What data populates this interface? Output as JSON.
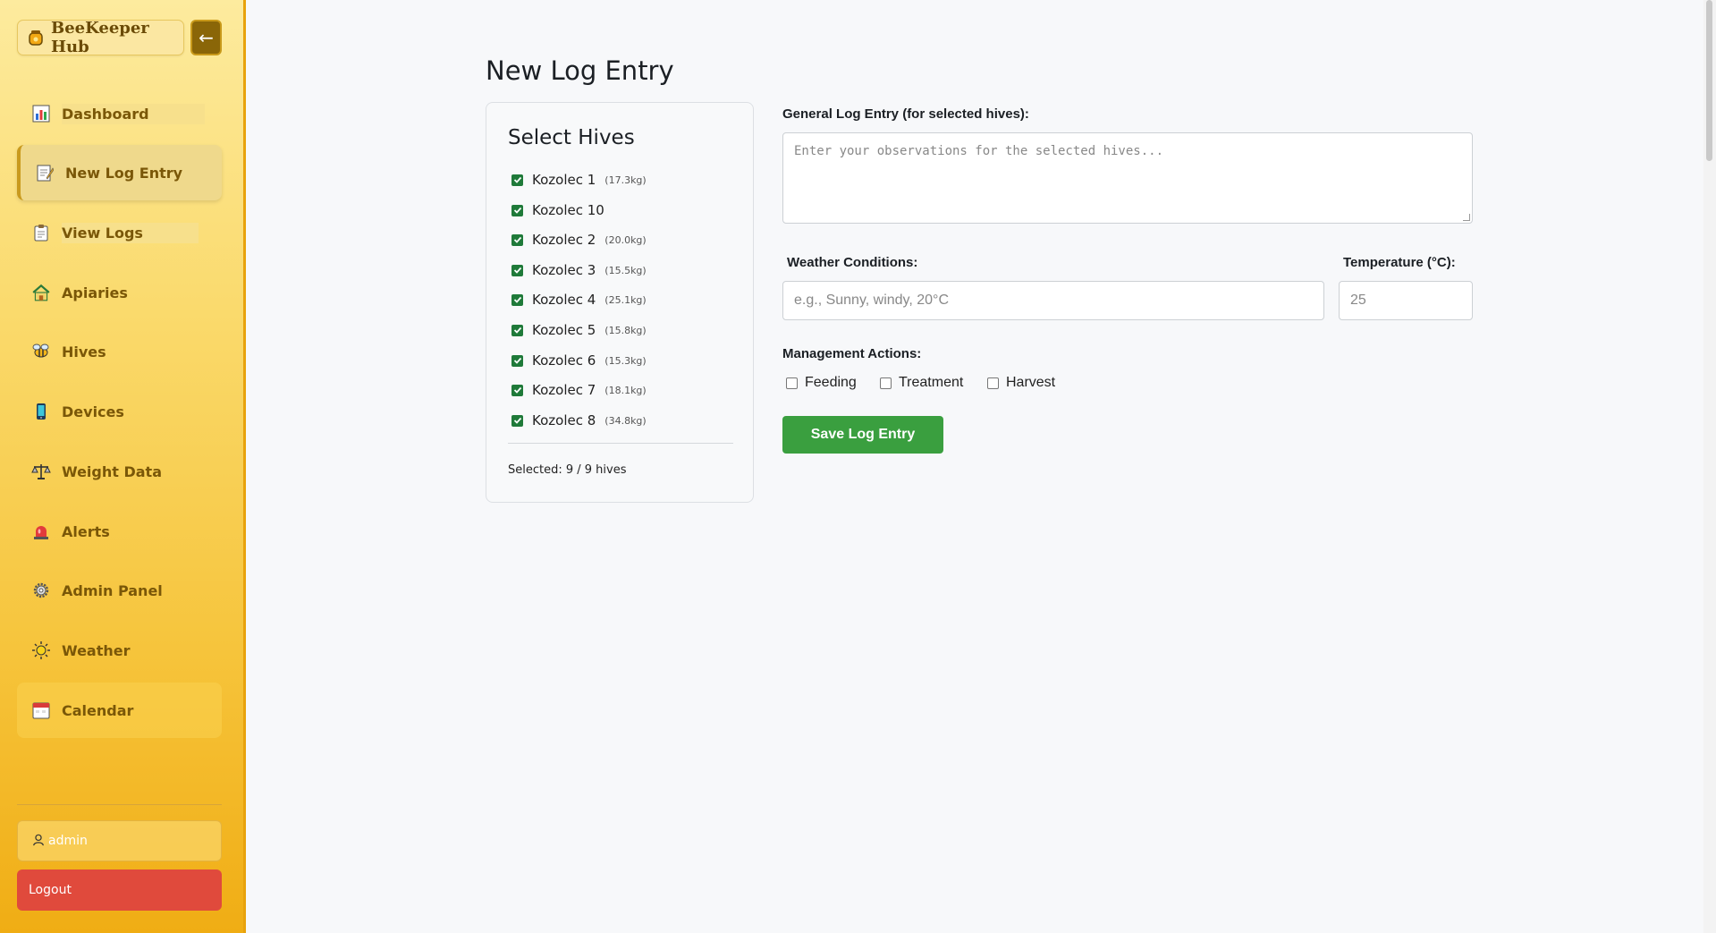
{
  "app": {
    "title": "BeeKeeper Hub",
    "collapse_label": "←"
  },
  "sidebar": {
    "items": [
      {
        "label": "Dashboard",
        "icon": "chart-icon"
      },
      {
        "label": "New Log Entry",
        "icon": "memo-icon",
        "active": true
      },
      {
        "label": "View Logs",
        "icon": "clipboard-icon"
      },
      {
        "label": "Apiaries",
        "icon": "house-icon"
      },
      {
        "label": "Hives",
        "icon": "bee-icon"
      },
      {
        "label": "Devices",
        "icon": "phone-icon"
      },
      {
        "label": "Weight Data",
        "icon": "scale-icon"
      },
      {
        "label": "Alerts",
        "icon": "siren-icon"
      },
      {
        "label": "Admin Panel",
        "icon": "gear-icon"
      },
      {
        "label": "Weather",
        "icon": "sun-icon"
      },
      {
        "label": "Calendar",
        "icon": "calendar-icon"
      }
    ],
    "user": "admin",
    "logout_label": "Logout"
  },
  "main": {
    "title": "New Log Entry",
    "hives_panel": {
      "title": "Select Hives",
      "hives": [
        {
          "name": "Kozolec 1",
          "weight": "(17.3kg)",
          "checked": true
        },
        {
          "name": "Kozolec 10",
          "weight": "",
          "checked": true
        },
        {
          "name": "Kozolec 2",
          "weight": "(20.0kg)",
          "checked": true
        },
        {
          "name": "Kozolec 3",
          "weight": "(15.5kg)",
          "checked": true
        },
        {
          "name": "Kozolec 4",
          "weight": "(25.1kg)",
          "checked": true
        },
        {
          "name": "Kozolec 5",
          "weight": "(15.8kg)",
          "checked": true
        },
        {
          "name": "Kozolec 6",
          "weight": "(15.3kg)",
          "checked": true
        },
        {
          "name": "Kozolec 7",
          "weight": "(18.1kg)",
          "checked": true
        },
        {
          "name": "Kozolec 8",
          "weight": "(34.8kg)",
          "checked": true
        }
      ],
      "selected_text": "Selected: 9 / 9 hives"
    },
    "form": {
      "general_label": "General Log Entry (for selected hives):",
      "general_placeholder": "Enter your observations for the selected hives...",
      "weather_label": "Weather Conditions:",
      "weather_placeholder": "e.g., Sunny, windy, 20°C",
      "temp_label": "Temperature (°C):",
      "temp_placeholder": "25",
      "actions_label": "Management Actions:",
      "actions": [
        {
          "label": "Feeding",
          "checked": false
        },
        {
          "label": "Treatment",
          "checked": false
        },
        {
          "label": "Harvest",
          "checked": false
        }
      ],
      "save_label": "Save Log Entry"
    }
  },
  "colors": {
    "accent": "#f6c43b",
    "save": "#3a9f3f",
    "logout": "#e04a3c",
    "brand_text": "#6b4b07"
  }
}
